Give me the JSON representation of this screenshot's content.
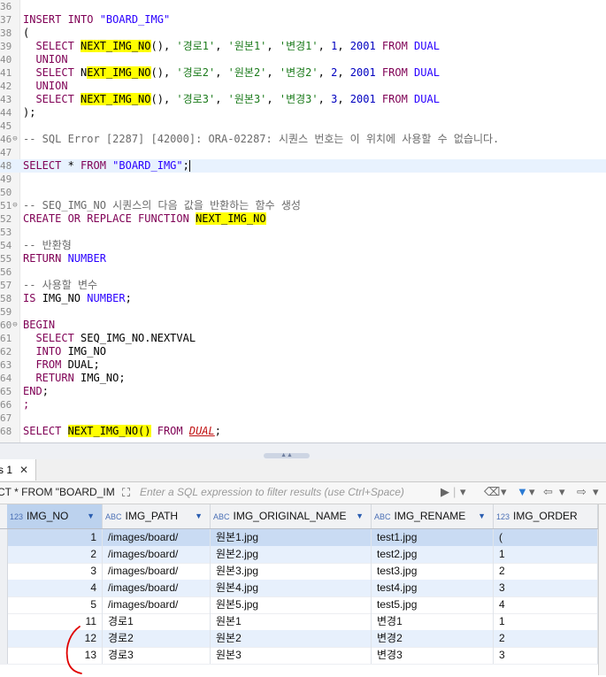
{
  "editor": {
    "lines": [
      {
        "n": "36",
        "fold": "",
        "parts": []
      },
      {
        "n": "37",
        "fold": "",
        "parts": [
          [
            "kw",
            "INSERT INTO "
          ],
          [
            "str",
            "\"BOARD_IMG\""
          ]
        ]
      },
      {
        "n": "38",
        "fold": "",
        "parts": [
          [
            "id",
            "("
          ]
        ]
      },
      {
        "n": "39",
        "fold": "",
        "parts": [
          [
            "kw",
            "  SELECT "
          ],
          [
            "hl",
            "NEXT_IMG_NO"
          ],
          [
            "id",
            "(), "
          ],
          [
            "strk",
            "'경로1'"
          ],
          [
            "id",
            ", "
          ],
          [
            "strk",
            "'원본1'"
          ],
          [
            "id",
            ", "
          ],
          [
            "strk",
            "'변경1'"
          ],
          [
            "id",
            ", "
          ],
          [
            "num",
            "1"
          ],
          [
            "id",
            ", "
          ],
          [
            "num",
            "2001"
          ],
          [
            "kw",
            " FROM "
          ],
          [
            "str",
            "DUAL"
          ]
        ]
      },
      {
        "n": "40",
        "fold": "",
        "parts": [
          [
            "kw",
            "  UNION"
          ]
        ]
      },
      {
        "n": "41",
        "fold": "",
        "parts": [
          [
            "kw",
            "  SELECT "
          ],
          [
            "id",
            "N"
          ],
          [
            "hl",
            "EXT_IMG_NO"
          ],
          [
            "id",
            "(), "
          ],
          [
            "strk",
            "'경로2'"
          ],
          [
            "id",
            ", "
          ],
          [
            "strk",
            "'원본2'"
          ],
          [
            "id",
            ", "
          ],
          [
            "strk",
            "'변경2'"
          ],
          [
            "id",
            ", "
          ],
          [
            "num",
            "2"
          ],
          [
            "id",
            ", "
          ],
          [
            "num",
            "2001"
          ],
          [
            "kw",
            " FROM "
          ],
          [
            "str",
            "DUAL"
          ]
        ]
      },
      {
        "n": "42",
        "fold": "",
        "parts": [
          [
            "kw",
            "  UNION"
          ]
        ]
      },
      {
        "n": "43",
        "fold": "",
        "parts": [
          [
            "kw",
            "  SELECT "
          ],
          [
            "hl",
            "NEXT_IMG_NO"
          ],
          [
            "id",
            "(), "
          ],
          [
            "strk",
            "'경로3'"
          ],
          [
            "id",
            ", "
          ],
          [
            "strk",
            "'원본3'"
          ],
          [
            "id",
            ", "
          ],
          [
            "strk",
            "'변경3'"
          ],
          [
            "id",
            ", "
          ],
          [
            "num",
            "3"
          ],
          [
            "id",
            ", "
          ],
          [
            "num",
            "2001"
          ],
          [
            "kw",
            " FROM "
          ],
          [
            "str",
            "DUAL"
          ]
        ]
      },
      {
        "n": "44",
        "fold": "",
        "parts": [
          [
            "id",
            ");"
          ]
        ]
      },
      {
        "n": "45",
        "fold": "",
        "parts": []
      },
      {
        "n": "46",
        "fold": "⊖",
        "parts": [
          [
            "cm",
            "-- SQL Error [2287] [42000]: ORA-02287: 시퀀스 번호는 이 위치에 사용할 수 없습니다."
          ]
        ]
      },
      {
        "n": "47",
        "fold": "",
        "parts": []
      },
      {
        "n": "48",
        "fold": "",
        "current": true,
        "parts": [
          [
            "kw",
            "SELECT "
          ],
          [
            "id",
            "* "
          ],
          [
            "kw",
            "FROM "
          ],
          [
            "str",
            "\"BOARD_IMG\""
          ],
          [
            "id",
            ";"
          ],
          [
            "caret",
            ""
          ]
        ]
      },
      {
        "n": "49",
        "fold": "",
        "parts": []
      },
      {
        "n": "50",
        "fold": "",
        "parts": []
      },
      {
        "n": "51",
        "fold": "⊖",
        "parts": [
          [
            "cm",
            "-- SEQ_IMG_NO 시퀀스의 다음 값을 반환하는 함수 생성"
          ]
        ]
      },
      {
        "n": "52",
        "fold": "",
        "parts": [
          [
            "kw",
            "CREATE OR REPLACE FUNCTION "
          ],
          [
            "hl",
            "NEXT_IMG_NO"
          ]
        ]
      },
      {
        "n": "53",
        "fold": "",
        "parts": []
      },
      {
        "n": "54",
        "fold": "",
        "parts": [
          [
            "cm",
            "-- 반환형"
          ]
        ]
      },
      {
        "n": "55",
        "fold": "",
        "parts": [
          [
            "kw",
            "RETURN "
          ],
          [
            "str",
            "NUMBER"
          ]
        ]
      },
      {
        "n": "56",
        "fold": "",
        "parts": []
      },
      {
        "n": "57",
        "fold": "",
        "parts": [
          [
            "cm",
            "-- 사용할 변수"
          ]
        ]
      },
      {
        "n": "58",
        "fold": "",
        "parts": [
          [
            "kw",
            "IS "
          ],
          [
            "id",
            "IMG_NO "
          ],
          [
            "str",
            "NUMBER"
          ],
          [
            "id",
            ";"
          ]
        ]
      },
      {
        "n": "59",
        "fold": "",
        "parts": []
      },
      {
        "n": "60",
        "fold": "⊖",
        "parts": [
          [
            "kw",
            "BEGIN"
          ]
        ]
      },
      {
        "n": "61",
        "fold": "",
        "parts": [
          [
            "kw",
            "  SELECT "
          ],
          [
            "id",
            "SEQ_IMG_NO.NEXTVAL"
          ]
        ]
      },
      {
        "n": "62",
        "fold": "",
        "parts": [
          [
            "kw",
            "  INTO "
          ],
          [
            "id",
            "IMG_NO"
          ]
        ]
      },
      {
        "n": "63",
        "fold": "",
        "parts": [
          [
            "kw",
            "  FROM "
          ],
          [
            "id",
            "DUAL;"
          ]
        ]
      },
      {
        "n": "64",
        "fold": "",
        "parts": [
          [
            "kw",
            "  RETURN "
          ],
          [
            "id",
            "IMG_NO;"
          ]
        ]
      },
      {
        "n": "65",
        "fold": "",
        "parts": [
          [
            "kw",
            "END"
          ],
          [
            "id",
            ";"
          ]
        ]
      },
      {
        "n": "66",
        "fold": "",
        "parts": [
          [
            "kw",
            ";"
          ]
        ]
      },
      {
        "n": "67",
        "fold": "",
        "parts": []
      },
      {
        "n": "68",
        "fold": "",
        "parts": [
          [
            "kw",
            "SELECT "
          ],
          [
            "hl",
            "NEXT_IMG_NO()"
          ],
          [
            "kw",
            " FROM "
          ],
          [
            "dual",
            "DUAL"
          ],
          [
            "id",
            ";"
          ]
        ]
      }
    ]
  },
  "results_tab": {
    "label": "s 1",
    "close": "✕"
  },
  "filter": {
    "query": "CT * FROM \"BOARD_IMG",
    "placeholder": "Enter a SQL expression to filter results (use Ctrl+Space)"
  },
  "grid": {
    "columns": [
      {
        "type": "123",
        "name": "IMG_NO"
      },
      {
        "type": "ABC",
        "name": "IMG_PATH"
      },
      {
        "type": "ABC",
        "name": "IMG_ORIGINAL_NAME"
      },
      {
        "type": "ABC",
        "name": "IMG_RENAME"
      },
      {
        "type": "123",
        "name": "IMG_ORDER"
      }
    ],
    "rows": [
      [
        "1",
        "/images/board/",
        "원본1.jpg",
        "test1.jpg",
        "("
      ],
      [
        "2",
        "/images/board/",
        "원본2.jpg",
        "test2.jpg",
        "1"
      ],
      [
        "3",
        "/images/board/",
        "원본3.jpg",
        "test3.jpg",
        "2"
      ],
      [
        "4",
        "/images/board/",
        "원본4.jpg",
        "test4.jpg",
        "3"
      ],
      [
        "5",
        "/images/board/",
        "원본5.jpg",
        "test5.jpg",
        "4"
      ],
      [
        "11",
        "경로1",
        "원본1",
        "변경1",
        "1"
      ],
      [
        "12",
        "경로2",
        "원본2",
        "변경2",
        "2"
      ],
      [
        "13",
        "경로3",
        "원본3",
        "변경3",
        "3"
      ]
    ]
  },
  "colors": {
    "highlight": "#ffff00",
    "keyword": "#7f0055",
    "string": "#2a00ff",
    "annotation": "#e00000"
  }
}
